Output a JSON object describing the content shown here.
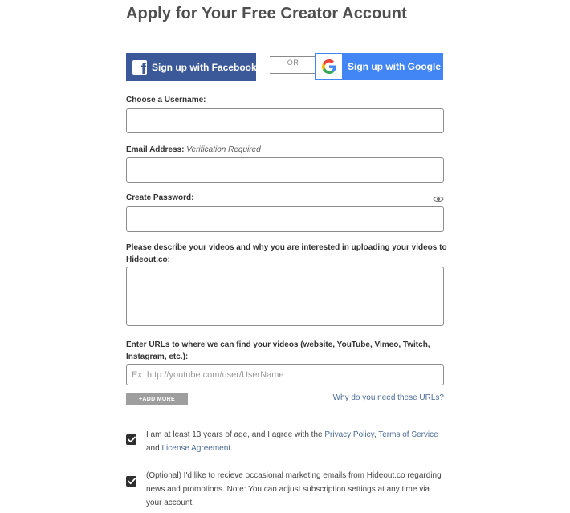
{
  "header": {
    "title": "Apply for Your Free Creator Account"
  },
  "social": {
    "facebook_label": "Sign up with Facebook",
    "or_label": "OR",
    "google_label": "Sign up with Google",
    "facebook_icon": "facebook-f-icon",
    "google_icon": "google-g-icon"
  },
  "form": {
    "username": {
      "label": "Choose a Username:",
      "value": ""
    },
    "email": {
      "label": "Email Address:",
      "hint": "Verification Required",
      "value": ""
    },
    "password": {
      "label": "Create Password:",
      "value": "",
      "toggle_icon": "eye-icon"
    },
    "description": {
      "label": "Please describe your videos and why you are interested in uploading your videos to Hideout.co:",
      "value": ""
    },
    "urls": {
      "label": "Enter URLs to where we can find your videos (website, YouTube, Vimeo, Twitch, Instagram, etc.):",
      "placeholder": "Ex: http://youtube.com/user/UserName",
      "value": ""
    },
    "add_more_label": "+ADD MORE",
    "why_link": "Why do you need these URLs?"
  },
  "agreements": {
    "age": {
      "checked": true,
      "text_before": "I am at least 13 years of age, and I agree with the ",
      "privacy": "Privacy Policy",
      "comma": ", ",
      "terms": "Terms of Service",
      "and": " and ",
      "license": "License Agreement",
      "end": "."
    },
    "marketing": {
      "checked": true,
      "text": "(Optional) I'd like to recieve occasional marketing emails from Hideout.co regarding news and promotions. Note: You can adjust subscription settings at any time via your account."
    }
  },
  "colors": {
    "facebook": "#3b5998",
    "google": "#4285f4",
    "link": "#4a6b94",
    "checkbox": "#2f2f2f",
    "add_more": "#9e9e9e"
  }
}
